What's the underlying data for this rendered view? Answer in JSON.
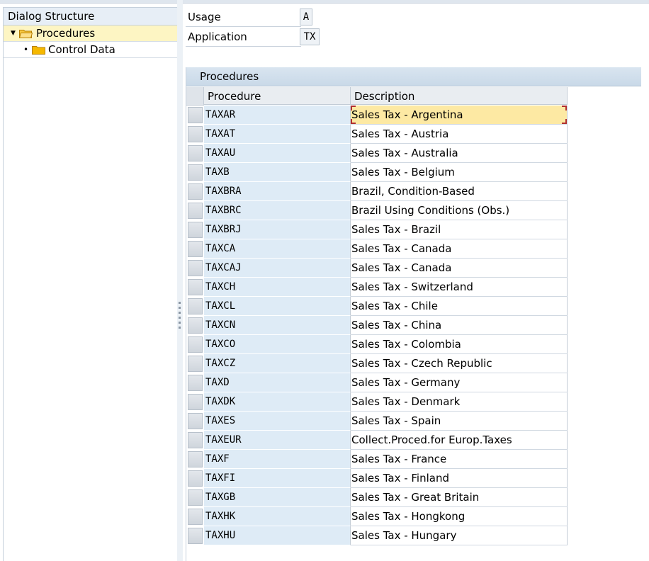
{
  "dialog_structure": {
    "title": "Dialog Structure",
    "items": [
      {
        "label": "Procedures",
        "expanded": true,
        "selected": true,
        "icon": "folder-open-icon"
      },
      {
        "label": "Control Data",
        "expanded": false,
        "selected": false,
        "icon": "folder-icon"
      }
    ]
  },
  "header_fields": {
    "usage_label": "Usage",
    "usage_value": "A",
    "application_label": "Application",
    "application_value": "TX"
  },
  "procedures_table": {
    "title": "Procedures",
    "columns": [
      "Procedure",
      "Description"
    ],
    "rows": [
      {
        "procedure": "TAXAR",
        "description": "Sales Tax - Argentina"
      },
      {
        "procedure": "TAXAT",
        "description": "Sales Tax - Austria"
      },
      {
        "procedure": "TAXAU",
        "description": "Sales Tax - Australia"
      },
      {
        "procedure": "TAXB",
        "description": "Sales Tax - Belgium"
      },
      {
        "procedure": "TAXBRA",
        "description": "Brazil, Condition-Based"
      },
      {
        "procedure": "TAXBRC",
        "description": "Brazil Using Conditions (Obs.)"
      },
      {
        "procedure": "TAXBRJ",
        "description": "Sales Tax - Brazil"
      },
      {
        "procedure": "TAXCA",
        "description": "Sales Tax - Canada"
      },
      {
        "procedure": "TAXCAJ",
        "description": "Sales Tax - Canada"
      },
      {
        "procedure": "TAXCH",
        "description": "Sales Tax - Switzerland"
      },
      {
        "procedure": "TAXCL",
        "description": "Sales Tax - Chile"
      },
      {
        "procedure": "TAXCN",
        "description": "Sales Tax - China"
      },
      {
        "procedure": "TAXCO",
        "description": "Sales Tax - Colombia"
      },
      {
        "procedure": "TAXCZ",
        "description": "Sales Tax - Czech Republic"
      },
      {
        "procedure": "TAXD",
        "description": "Sales Tax - Germany"
      },
      {
        "procedure": "TAXDK",
        "description": "Sales Tax - Denmark"
      },
      {
        "procedure": "TAXES",
        "description": "Sales Tax - Spain"
      },
      {
        "procedure": "TAXEUR",
        "description": "Collect.Proced.for Europ.Taxes"
      },
      {
        "procedure": "TAXF",
        "description": "Sales Tax - France"
      },
      {
        "procedure": "TAXFI",
        "description": "Sales Tax - Finland"
      },
      {
        "procedure": "TAXGB",
        "description": "Sales Tax - Great Britain"
      },
      {
        "procedure": "TAXHK",
        "description": "Sales Tax - Hongkong"
      },
      {
        "procedure": "TAXHU",
        "description": "Sales Tax - Hungary"
      }
    ],
    "focused_row": 0
  },
  "icons": {
    "tree_expand": "triangle-down-icon",
    "tree_leaf": "bullet-icon",
    "scroll_left": "arrow-left-icon",
    "scroll_right": "arrow-right-icon"
  },
  "colors": {
    "selected_tree_row": "#fdf5c3",
    "focused_cell": "#fde9a3",
    "key_column": "#deebf6",
    "folder": "#f5b800"
  }
}
